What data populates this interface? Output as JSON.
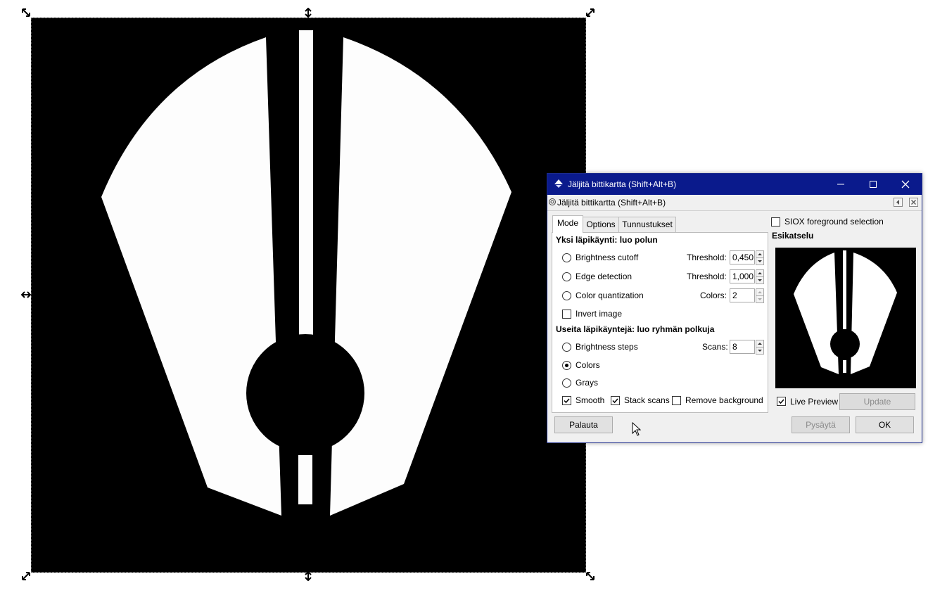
{
  "dialog": {
    "title": "Jäljitä bittikartta (Shift+Alt+B)",
    "dock_title": "Jäljitä bittikartta (Shift+Alt+B)"
  },
  "tabs": [
    {
      "label": "Mode",
      "active": true
    },
    {
      "label": "Options",
      "active": false
    },
    {
      "label": "Tunnustukset",
      "active": false
    }
  ],
  "single_scan": {
    "heading": "Yksi läpikäynti: luo polun",
    "brightness_cutoff": {
      "label": "Brightness cutoff",
      "selected": false,
      "param_label": "Threshold:",
      "value": "0,450"
    },
    "edge_detection": {
      "label": "Edge detection",
      "selected": false,
      "param_label": "Threshold:",
      "value": "1,000"
    },
    "color_quantization": {
      "label": "Color quantization",
      "selected": false,
      "param_label": "Colors:",
      "value": "2"
    },
    "invert_image": {
      "label": "Invert image",
      "checked": false
    }
  },
  "multi_scan": {
    "heading": "Useita läpikäyntejä: luo ryhmän polkuja",
    "brightness_steps": {
      "label": "Brightness steps",
      "selected": false,
      "param_label": "Scans:",
      "value": "8"
    },
    "colors": {
      "label": "Colors",
      "selected": true
    },
    "grays": {
      "label": "Grays",
      "selected": false
    },
    "smooth": {
      "label": "Smooth",
      "checked": true
    },
    "stack_scans": {
      "label": "Stack scans",
      "checked": true
    },
    "remove_background": {
      "label": "Remove background",
      "checked": false
    }
  },
  "siox": {
    "label": "SIOX foreground selection",
    "checked": false
  },
  "preview": {
    "heading": "Esikatselu",
    "live_preview_label": "Live Preview",
    "live_preview_checked": true,
    "update_label": "Update"
  },
  "buttons": {
    "reset": "Palauta",
    "stop": "Pysäytä",
    "ok": "OK"
  },
  "icons": {
    "app": "inkscape-icon",
    "dock": "trace-bitmap-icon"
  },
  "colors": {
    "titlebar": "#0a1a8c",
    "canvas_bg": "#000000",
    "shape_fill": "#fdfdfd"
  }
}
